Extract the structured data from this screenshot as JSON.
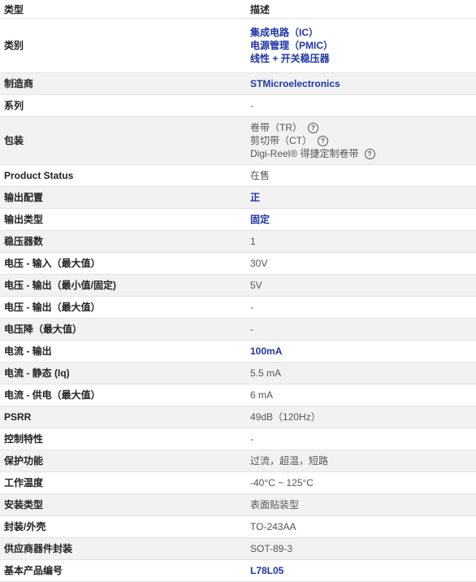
{
  "header": {
    "type_label": "类型",
    "desc_label": "描述"
  },
  "rows": {
    "category": {
      "label": "类别",
      "links": [
        "集成电路（IC）",
        "电源管理（PMIC）",
        "线性 + 开关稳压器"
      ]
    },
    "manufacturer": {
      "label": "制造商",
      "value": "STMicroelectronics"
    },
    "series": {
      "label": "系列",
      "value": "-"
    },
    "packaging": {
      "label": "包装",
      "items": [
        "卷带（TR）",
        "剪切带（CT）",
        "Digi-Reel® 得捷定制卷带"
      ],
      "help_glyph": "?"
    },
    "product_status": {
      "label": "Product Status",
      "value": "在售"
    },
    "output_config": {
      "label": "输出配置",
      "value": "正"
    },
    "output_type": {
      "label": "输出类型",
      "value": "固定"
    },
    "num_regulators": {
      "label": "稳压器数",
      "value": "1"
    },
    "voltage_in_max": {
      "label": "电压 - 输入（最大值）",
      "value": "30V"
    },
    "voltage_out_min": {
      "label": "电压 - 输出（最小值/固定)",
      "value": "5V"
    },
    "voltage_out_max": {
      "label": "电压 - 输出（最大值）",
      "value": "-"
    },
    "dropout_max": {
      "label": "电压降（最大值）",
      "value": "-"
    },
    "current_out": {
      "label": "电流 - 输出",
      "value": "100mA"
    },
    "current_quiescent": {
      "label": "电流 - 静态 (Iq)",
      "value": "5.5 mA"
    },
    "current_supply_max": {
      "label": "电流 - 供电（最大值）",
      "value": "6 mA"
    },
    "psrr": {
      "label": "PSRR",
      "value": "49dB（120Hz）"
    },
    "control_features": {
      "label": "控制特性",
      "value": "-"
    },
    "protection": {
      "label": "保护功能",
      "value": "过流，超温，短路"
    },
    "operating_temp": {
      "label": "工作温度",
      "value": "-40°C ~ 125°C"
    },
    "mounting_type": {
      "label": "安装类型",
      "value": "表面贴装型"
    },
    "package_case": {
      "label": "封装/外壳",
      "value": "TO-243AA"
    },
    "supplier_package": {
      "label": "供应商器件封装",
      "value": "SOT-89-3"
    },
    "base_part_number": {
      "label": "基本产品编号",
      "value": "L78L05"
    }
  },
  "colors": {
    "link": "#1f36a8",
    "alt_row": "#f2f2f2",
    "border": "#e3e3e3"
  }
}
